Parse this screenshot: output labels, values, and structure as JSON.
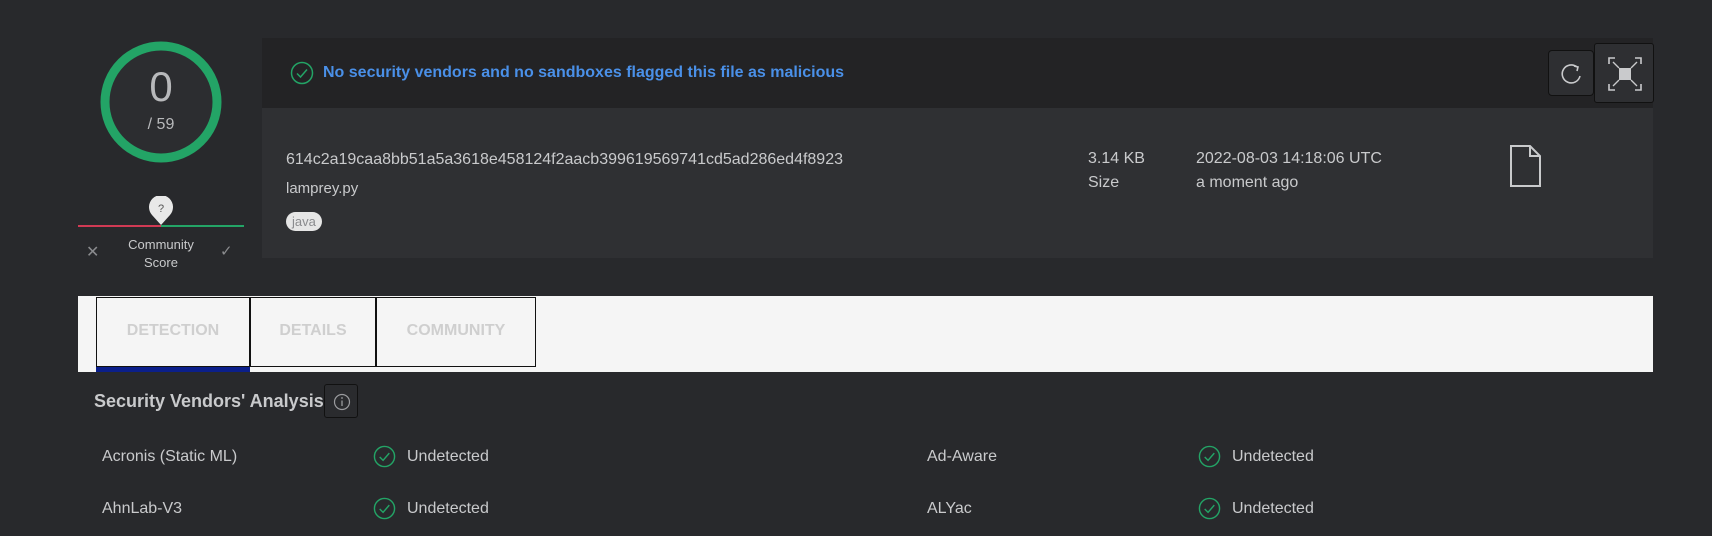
{
  "score": {
    "detections": "0",
    "total": "/ 59"
  },
  "community": {
    "label": "Community Score",
    "marker": "?"
  },
  "summary": {
    "message": "No security vendors and no sandboxes flagged this file as malicious",
    "hash": "614c2a19caa8bb51a5a3618e458124f2aacb399619569741cd5ad286ed4f8923",
    "filename": "lamprey.py",
    "tag": "java",
    "size_value": "3.14 KB",
    "size_label": "Size",
    "date": "2022-08-03 14:18:06 UTC",
    "date_ago": "a moment ago"
  },
  "tabs": [
    {
      "label": "DETECTION",
      "active": true
    },
    {
      "label": "DETAILS",
      "active": false
    },
    {
      "label": "COMMUNITY",
      "active": false
    }
  ],
  "section": {
    "title": "Security Vendors' Analysis"
  },
  "vendors": [
    {
      "name": "Acronis (Static ML)",
      "status": "Undetected"
    },
    {
      "name": "Ad-Aware",
      "status": "Undetected"
    },
    {
      "name": "AhnLab-V3",
      "status": "Undetected"
    },
    {
      "name": "ALYac",
      "status": "Undetected"
    }
  ],
  "colors": {
    "background": "#28292c",
    "ring": "#23a466",
    "accent_blue": "#4a90e8",
    "tab_active": "#0b1f8a",
    "negative": "#d13a54"
  },
  "icons": [
    "check-circle-icon",
    "refresh-icon",
    "graph-icon",
    "file-icon",
    "info-icon",
    "close-icon",
    "check-icon"
  ]
}
